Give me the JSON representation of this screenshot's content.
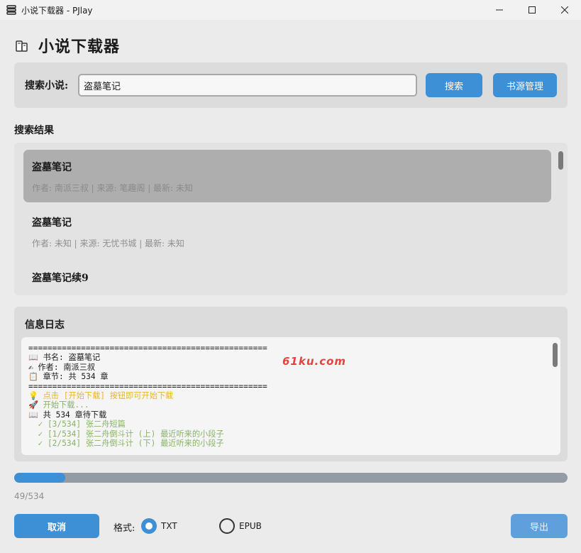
{
  "window": {
    "title": "小说下载器 - PJlay"
  },
  "header": {
    "title": "小说下载器",
    "icon": "books-icon"
  },
  "search": {
    "label": "搜索小说:",
    "value": "盗墓笔记",
    "search_button": "搜索",
    "source_button": "书源管理"
  },
  "results": {
    "title": "搜索结果",
    "items": [
      {
        "name": "盗墓笔记",
        "meta": "作者: 南派三叔 | 来源: 笔趣阁 | 最新: 未知",
        "selected": true
      },
      {
        "name": "盗墓笔记",
        "meta": "作者: 未知 | 来源: 无忧书城 | 最新: 未知",
        "selected": false
      },
      {
        "name": "盗墓笔记续9",
        "meta": "",
        "selected": false
      }
    ]
  },
  "log": {
    "title": "信息日志",
    "watermark": "61ku.com",
    "lines": [
      {
        "text": "==================================================",
        "color": "#1a1a1a"
      },
      {
        "text": "📖 书名: 盗墓笔记",
        "color": "#1a1a1a"
      },
      {
        "text": "✍ 作者: 南派三叔",
        "color": "#1a1a1a"
      },
      {
        "text": "📋 章节: 共 534 章",
        "color": "#1a1a1a"
      },
      {
        "text": "==================================================",
        "color": "#1a1a1a"
      },
      {
        "text": "💡 点击 [开始下载] 按钮即可开始下载",
        "color": "#e6b52e"
      },
      {
        "text": "🚀 开始下载...",
        "color": "#86b366"
      },
      {
        "text": "📖 共 534 章待下载",
        "color": "#1a1a1a"
      },
      {
        "text": "  ✓ [3/534] 张二舟短篇",
        "color": "#86b366"
      },
      {
        "text": "  ✓ [1/534] 张二舟倒斗计 (上) 最近听来的小段子",
        "color": "#86b366"
      },
      {
        "text": "  ✓ [2/534] 张二舟倒斗计 (下) 最近听来的小段子",
        "color": "#86b366"
      }
    ]
  },
  "progress": {
    "current": 49,
    "total": 534,
    "text": "49/534"
  },
  "footer": {
    "cancel_button": "取消",
    "format_label": "格式:",
    "formats": [
      {
        "label": "TXT",
        "selected": true
      },
      {
        "label": "EPUB",
        "selected": false
      }
    ],
    "export_button": "导出"
  },
  "colors": {
    "accent": "#3d8fd6",
    "panel": "#dcdcdc",
    "log_yellow": "#e6b52e",
    "log_green": "#86b366"
  }
}
